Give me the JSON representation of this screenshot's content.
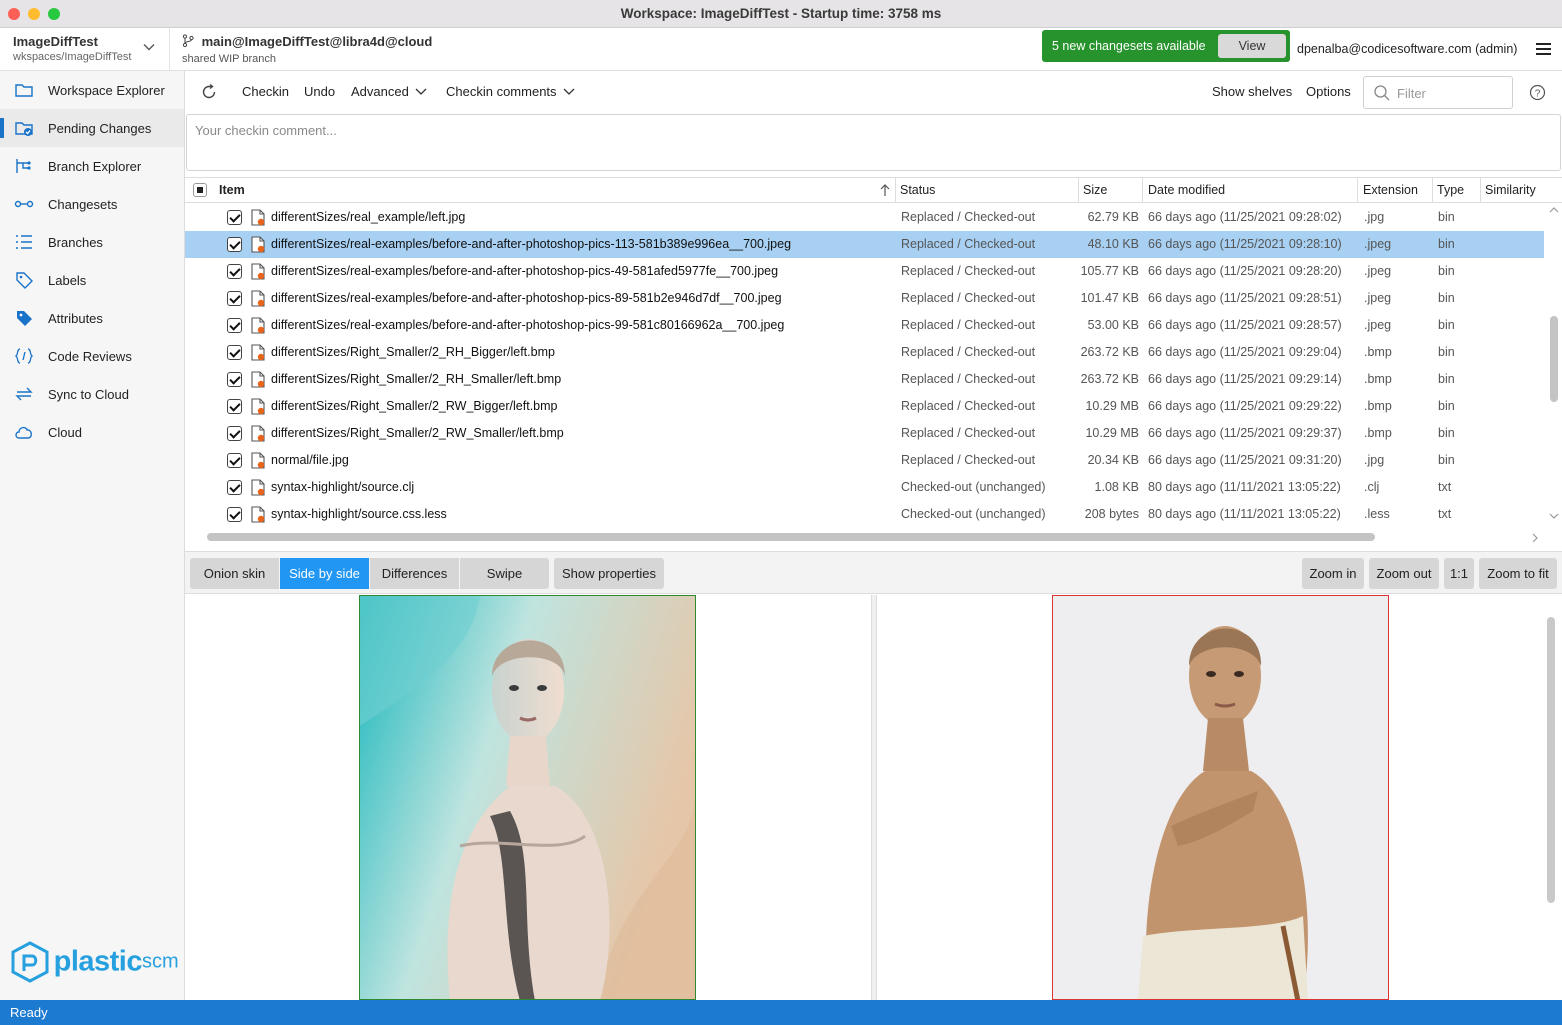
{
  "window": {
    "title": "Workspace: ImageDiffTest - Startup time: 3758 ms"
  },
  "workspace": {
    "name": "ImageDiffTest",
    "path": "wkspaces/ImageDiffTest"
  },
  "branch": {
    "name": "main@ImageDiffTest@libra4d@cloud",
    "subtitle": "shared WIP branch"
  },
  "notification": {
    "text": "5 new changesets available",
    "button": "View"
  },
  "user": "dpenalba@codicesoftware.com (admin)",
  "sidebar": {
    "items": [
      {
        "label": "Workspace Explorer",
        "icon": "folder-icon"
      },
      {
        "label": "Pending Changes",
        "icon": "pending-changes-icon"
      },
      {
        "label": "Branch Explorer",
        "icon": "branch-explorer-icon"
      },
      {
        "label": "Changesets",
        "icon": "changesets-icon"
      },
      {
        "label": "Branches",
        "icon": "branches-icon"
      },
      {
        "label": "Labels",
        "icon": "label-icon"
      },
      {
        "label": "Attributes",
        "icon": "attributes-icon"
      },
      {
        "label": "Code Reviews",
        "icon": "code-review-icon"
      },
      {
        "label": "Sync to Cloud",
        "icon": "sync-icon"
      },
      {
        "label": "Cloud",
        "icon": "cloud-icon"
      }
    ],
    "active": "Pending Changes",
    "logo": {
      "main": "plastic",
      "suffix": "scm"
    }
  },
  "toolbar": {
    "checkin": "Checkin",
    "undo": "Undo",
    "advanced": "Advanced",
    "checkin_comments": "Checkin comments",
    "show_shelves": "Show shelves",
    "options": "Options",
    "filter_placeholder": "Filter"
  },
  "comment": {
    "placeholder": "Your checkin comment..."
  },
  "table": {
    "columns": [
      "Item",
      "Status",
      "Size",
      "Date modified",
      "Extension",
      "Type",
      "Similarity"
    ],
    "rows": [
      {
        "item": "differentSizes/real_example/left.jpg",
        "status": "Replaced / Checked-out",
        "size": "62.79 KB",
        "date": "66 days ago (11/25/2021 09:28:02)",
        "ext": ".jpg",
        "type": "bin",
        "selected": false
      },
      {
        "item": "differentSizes/real-examples/before-and-after-photoshop-pics-113-581b389e996ea__700.jpeg",
        "status": "Replaced / Checked-out",
        "size": "48.10 KB",
        "date": "66 days ago (11/25/2021 09:28:10)",
        "ext": ".jpeg",
        "type": "bin",
        "selected": true
      },
      {
        "item": "differentSizes/real-examples/before-and-after-photoshop-pics-49-581afed5977fe__700.jpeg",
        "status": "Replaced / Checked-out",
        "size": "105.77 KB",
        "date": "66 days ago (11/25/2021 09:28:20)",
        "ext": ".jpeg",
        "type": "bin",
        "selected": false
      },
      {
        "item": "differentSizes/real-examples/before-and-after-photoshop-pics-89-581b2e946d7df__700.jpeg",
        "status": "Replaced / Checked-out",
        "size": "101.47 KB",
        "date": "66 days ago (11/25/2021 09:28:51)",
        "ext": ".jpeg",
        "type": "bin",
        "selected": false
      },
      {
        "item": "differentSizes/real-examples/before-and-after-photoshop-pics-99-581c80166962a__700.jpeg",
        "status": "Replaced / Checked-out",
        "size": "53.00 KB",
        "date": "66 days ago (11/25/2021 09:28:57)",
        "ext": ".jpeg",
        "type": "bin",
        "selected": false
      },
      {
        "item": "differentSizes/Right_Smaller/2_RH_Bigger/left.bmp",
        "status": "Replaced / Checked-out",
        "size": "263.72 KB",
        "date": "66 days ago (11/25/2021 09:29:04)",
        "ext": ".bmp",
        "type": "bin",
        "selected": false
      },
      {
        "item": "differentSizes/Right_Smaller/2_RH_Smaller/left.bmp",
        "status": "Replaced / Checked-out",
        "size": "263.72 KB",
        "date": "66 days ago (11/25/2021 09:29:14)",
        "ext": ".bmp",
        "type": "bin",
        "selected": false
      },
      {
        "item": "differentSizes/Right_Smaller/2_RW_Bigger/left.bmp",
        "status": "Replaced / Checked-out",
        "size": "10.29 MB",
        "date": "66 days ago (11/25/2021 09:29:22)",
        "ext": ".bmp",
        "type": "bin",
        "selected": false
      },
      {
        "item": "differentSizes/Right_Smaller/2_RW_Smaller/left.bmp",
        "status": "Replaced / Checked-out",
        "size": "10.29 MB",
        "date": "66 days ago (11/25/2021 09:29:37)",
        "ext": ".bmp",
        "type": "bin",
        "selected": false
      },
      {
        "item": "normal/file.jpg",
        "status": "Replaced / Checked-out",
        "size": "20.34 KB",
        "date": "66 days ago (11/25/2021 09:31:20)",
        "ext": ".jpg",
        "type": "bin",
        "selected": false
      },
      {
        "item": "syntax-highlight/source.clj",
        "status": "Checked-out (unchanged)",
        "size": "1.08 KB",
        "date": "80 days ago (11/11/2021 13:05:22)",
        "ext": ".clj",
        "type": "txt",
        "selected": false
      },
      {
        "item": "syntax-highlight/source.css.less",
        "status": "Checked-out (unchanged)",
        "size": "208 bytes",
        "date": "80 days ago (11/11/2021 13:05:22)",
        "ext": ".less",
        "type": "txt",
        "selected": false
      }
    ]
  },
  "viewer": {
    "modes": [
      "Onion skin",
      "Side by side",
      "Differences",
      "Swipe"
    ],
    "active_mode": "Side by side",
    "show_properties": "Show properties",
    "zoom_in": "Zoom in",
    "zoom_out": "Zoom out",
    "one_to_one": "1:1",
    "zoom_to_fit": "Zoom to fit"
  },
  "status": "Ready",
  "colors": {
    "accent": "#2196f3",
    "status_bar": "#1c7ad1",
    "notify": "#27932c",
    "selection": "#a7d0f3",
    "left_border": "#2f8a2f",
    "right_border": "#dd3333"
  }
}
